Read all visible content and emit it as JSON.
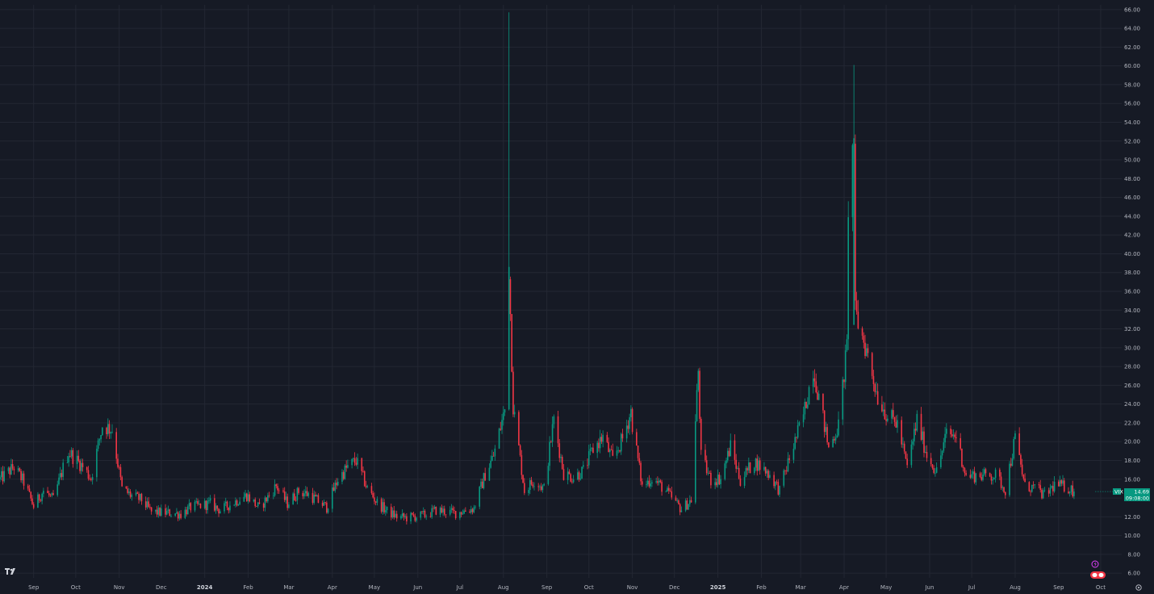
{
  "chart_data": {
    "type": "candlestick",
    "symbol": "VIX",
    "last_price": "14.69",
    "countdown": "09:08:00",
    "up_color": "#089981",
    "down_color": "#f23645",
    "background": "#161a25",
    "grid": true,
    "ylim": [
      5.5,
      66.5
    ],
    "y_ticks": [
      "6.00",
      "8.00",
      "10.00",
      "12.00",
      "14.00",
      "16.00",
      "18.00",
      "20.00",
      "22.00",
      "24.00",
      "26.00",
      "28.00",
      "30.00",
      "32.00",
      "34.00",
      "36.00",
      "38.00",
      "40.00",
      "42.00",
      "44.00",
      "46.00",
      "48.00",
      "50.00",
      "52.00",
      "54.00",
      "56.00",
      "58.00",
      "60.00",
      "62.00",
      "64.00",
      "66.00"
    ],
    "x_ticks": [
      {
        "label": "Sep",
        "date": "2023-09-01"
      },
      {
        "label": "Oct",
        "date": "2023-10-01"
      },
      {
        "label": "Nov",
        "date": "2023-11-01"
      },
      {
        "label": "Dec",
        "date": "2023-12-01"
      },
      {
        "label": "2024",
        "date": "2024-01-01",
        "bold": true
      },
      {
        "label": "Feb",
        "date": "2024-02-01"
      },
      {
        "label": "Mar",
        "date": "2024-03-01"
      },
      {
        "label": "Apr",
        "date": "2024-04-01"
      },
      {
        "label": "May",
        "date": "2024-05-01"
      },
      {
        "label": "Jun",
        "date": "2024-06-01"
      },
      {
        "label": "Jul",
        "date": "2024-07-01"
      },
      {
        "label": "Aug",
        "date": "2024-08-01"
      },
      {
        "label": "Sep",
        "date": "2024-09-01"
      },
      {
        "label": "Oct",
        "date": "2024-10-01"
      },
      {
        "label": "Nov",
        "date": "2024-11-01"
      },
      {
        "label": "Dec",
        "date": "2024-12-01"
      },
      {
        "label": "2025",
        "date": "2025-01-01",
        "bold": true
      },
      {
        "label": "Feb",
        "date": "2025-02-01"
      },
      {
        "label": "Mar",
        "date": "2025-03-01"
      },
      {
        "label": "Apr",
        "date": "2025-04-01"
      },
      {
        "label": "May",
        "date": "2025-05-01"
      },
      {
        "label": "Jun",
        "date": "2025-06-01"
      },
      {
        "label": "Jul",
        "date": "2025-07-01"
      },
      {
        "label": "Aug",
        "date": "2025-08-01"
      },
      {
        "label": "Sep",
        "date": "2025-09-01"
      },
      {
        "label": "Oct",
        "date": "2025-10-01"
      }
    ],
    "date_range": [
      "2023-08-08",
      "2025-10-16"
    ],
    "series": [
      {
        "date": "2023-08-08",
        "close": 16.0
      },
      {
        "date": "2023-08-18",
        "close": 17.3
      },
      {
        "date": "2023-08-25",
        "close": 15.7
      },
      {
        "date": "2023-09-01",
        "close": 13.1
      },
      {
        "date": "2023-09-08",
        "close": 14.8
      },
      {
        "date": "2023-09-15",
        "close": 13.8
      },
      {
        "date": "2023-09-22",
        "close": 17.2
      },
      {
        "date": "2023-09-26",
        "close": 18.9
      },
      {
        "date": "2023-10-05",
        "close": 17.5
      },
      {
        "date": "2023-10-12",
        "close": 16.1
      },
      {
        "date": "2023-10-20",
        "close": 21.7
      },
      {
        "date": "2023-10-27",
        "close": 21.3
      },
      {
        "date": "2023-11-03",
        "close": 15.0
      },
      {
        "date": "2023-11-10",
        "close": 14.2
      },
      {
        "date": "2023-11-17",
        "close": 13.8
      },
      {
        "date": "2023-11-24",
        "close": 12.5
      },
      {
        "date": "2023-12-08",
        "close": 12.4
      },
      {
        "date": "2023-12-15",
        "close": 12.3
      },
      {
        "date": "2023-12-22",
        "close": 13.0
      },
      {
        "date": "2024-01-05",
        "close": 13.4
      },
      {
        "date": "2024-01-12",
        "close": 12.7
      },
      {
        "date": "2024-01-19",
        "close": 13.3
      },
      {
        "date": "2024-01-31",
        "close": 14.3
      },
      {
        "date": "2024-02-09",
        "close": 12.9
      },
      {
        "date": "2024-02-21",
        "close": 15.3
      },
      {
        "date": "2024-02-29",
        "close": 13.4
      },
      {
        "date": "2024-03-08",
        "close": 14.7
      },
      {
        "date": "2024-03-15",
        "close": 14.4
      },
      {
        "date": "2024-03-28",
        "close": 13.0
      },
      {
        "date": "2024-04-05",
        "close": 16.0
      },
      {
        "date": "2024-04-12",
        "close": 17.3
      },
      {
        "date": "2024-04-18",
        "close": 18.0
      },
      {
        "date": "2024-04-26",
        "close": 15.0
      },
      {
        "date": "2024-05-03",
        "close": 13.5
      },
      {
        "date": "2024-05-10",
        "close": 12.6
      },
      {
        "date": "2024-05-17",
        "close": 12.0
      },
      {
        "date": "2024-05-24",
        "close": 11.9
      },
      {
        "date": "2024-06-07",
        "close": 12.2
      },
      {
        "date": "2024-06-14",
        "close": 12.7
      },
      {
        "date": "2024-06-28",
        "close": 12.4
      },
      {
        "date": "2024-07-11",
        "close": 12.9
      },
      {
        "date": "2024-07-19",
        "close": 16.5
      },
      {
        "date": "2024-07-25",
        "close": 18.5
      },
      {
        "date": "2024-08-02",
        "close": 23.4
      },
      {
        "date": "2024-08-05",
        "close": 38.6,
        "high": 65.7
      },
      {
        "date": "2024-08-08",
        "close": 23.8
      },
      {
        "date": "2024-08-16",
        "close": 14.8
      },
      {
        "date": "2024-08-23",
        "close": 15.9
      },
      {
        "date": "2024-08-30",
        "close": 15.0
      },
      {
        "date": "2024-09-06",
        "close": 22.4
      },
      {
        "date": "2024-09-13",
        "close": 16.6
      },
      {
        "date": "2024-09-20",
        "close": 16.2
      },
      {
        "date": "2024-09-27",
        "close": 16.9
      },
      {
        "date": "2024-10-04",
        "close": 19.2
      },
      {
        "date": "2024-10-11",
        "close": 20.5
      },
      {
        "date": "2024-10-18",
        "close": 18.0
      },
      {
        "date": "2024-10-25",
        "close": 20.3
      },
      {
        "date": "2024-10-31",
        "close": 23.2
      },
      {
        "date": "2024-11-01",
        "close": 21.9
      },
      {
        "date": "2024-11-08",
        "close": 15.2
      },
      {
        "date": "2024-11-15",
        "close": 16.1
      },
      {
        "date": "2024-11-22",
        "close": 15.2
      },
      {
        "date": "2024-12-06",
        "close": 12.8
      },
      {
        "date": "2024-12-13",
        "close": 13.8
      },
      {
        "date": "2024-12-18",
        "close": 27.6
      },
      {
        "date": "2024-12-20",
        "close": 18.4
      },
      {
        "date": "2024-12-27",
        "close": 15.9
      },
      {
        "date": "2025-01-03",
        "close": 16.1
      },
      {
        "date": "2025-01-10",
        "close": 19.5
      },
      {
        "date": "2025-01-17",
        "close": 15.9
      },
      {
        "date": "2025-01-27",
        "close": 17.9
      },
      {
        "date": "2025-02-07",
        "close": 16.5
      },
      {
        "date": "2025-02-14",
        "close": 14.8
      },
      {
        "date": "2025-02-21",
        "close": 18.2
      },
      {
        "date": "2025-03-03",
        "close": 22.8
      },
      {
        "date": "2025-03-10",
        "close": 27.9
      },
      {
        "date": "2025-03-21",
        "close": 19.3
      },
      {
        "date": "2025-03-28",
        "close": 21.7
      },
      {
        "date": "2025-04-03",
        "close": 30.0
      },
      {
        "date": "2025-04-04",
        "close": 45.3
      },
      {
        "date": "2025-04-08",
        "close": 52.3,
        "high": 60.1
      },
      {
        "date": "2025-04-09",
        "close": 33.6
      },
      {
        "date": "2025-04-17",
        "close": 29.7
      },
      {
        "date": "2025-04-25",
        "close": 24.8
      },
      {
        "date": "2025-05-02",
        "close": 22.7
      },
      {
        "date": "2025-05-09",
        "close": 21.9
      },
      {
        "date": "2025-05-16",
        "close": 17.2
      },
      {
        "date": "2025-05-23",
        "close": 22.3
      },
      {
        "date": "2025-05-30",
        "close": 18.6
      },
      {
        "date": "2025-06-06",
        "close": 16.8
      },
      {
        "date": "2025-06-13",
        "close": 20.8
      },
      {
        "date": "2025-06-20",
        "close": 20.6
      },
      {
        "date": "2025-06-27",
        "close": 16.3
      },
      {
        "date": "2025-07-03",
        "close": 16.4
      },
      {
        "date": "2025-07-11",
        "close": 16.4
      },
      {
        "date": "2025-07-18",
        "close": 16.4
      },
      {
        "date": "2025-07-25",
        "close": 14.9
      },
      {
        "date": "2025-08-01",
        "close": 20.4
      },
      {
        "date": "2025-08-08",
        "close": 15.2
      },
      {
        "date": "2025-08-15",
        "close": 15.1
      },
      {
        "date": "2025-08-22",
        "close": 14.2
      },
      {
        "date": "2025-08-29",
        "close": 15.4
      },
      {
        "date": "2025-09-05",
        "close": 15.2
      },
      {
        "date": "2025-09-08",
        "close": 15.1
      },
      {
        "date": "2025-09-12",
        "close": 14.69
      }
    ]
  },
  "footer": {
    "logo_text": "TV"
  },
  "icons": {
    "settings": "gear-icon",
    "logo": "tradingview-logo-icon",
    "lightning": "lightning-icon",
    "toggle": "toggle-icon"
  }
}
